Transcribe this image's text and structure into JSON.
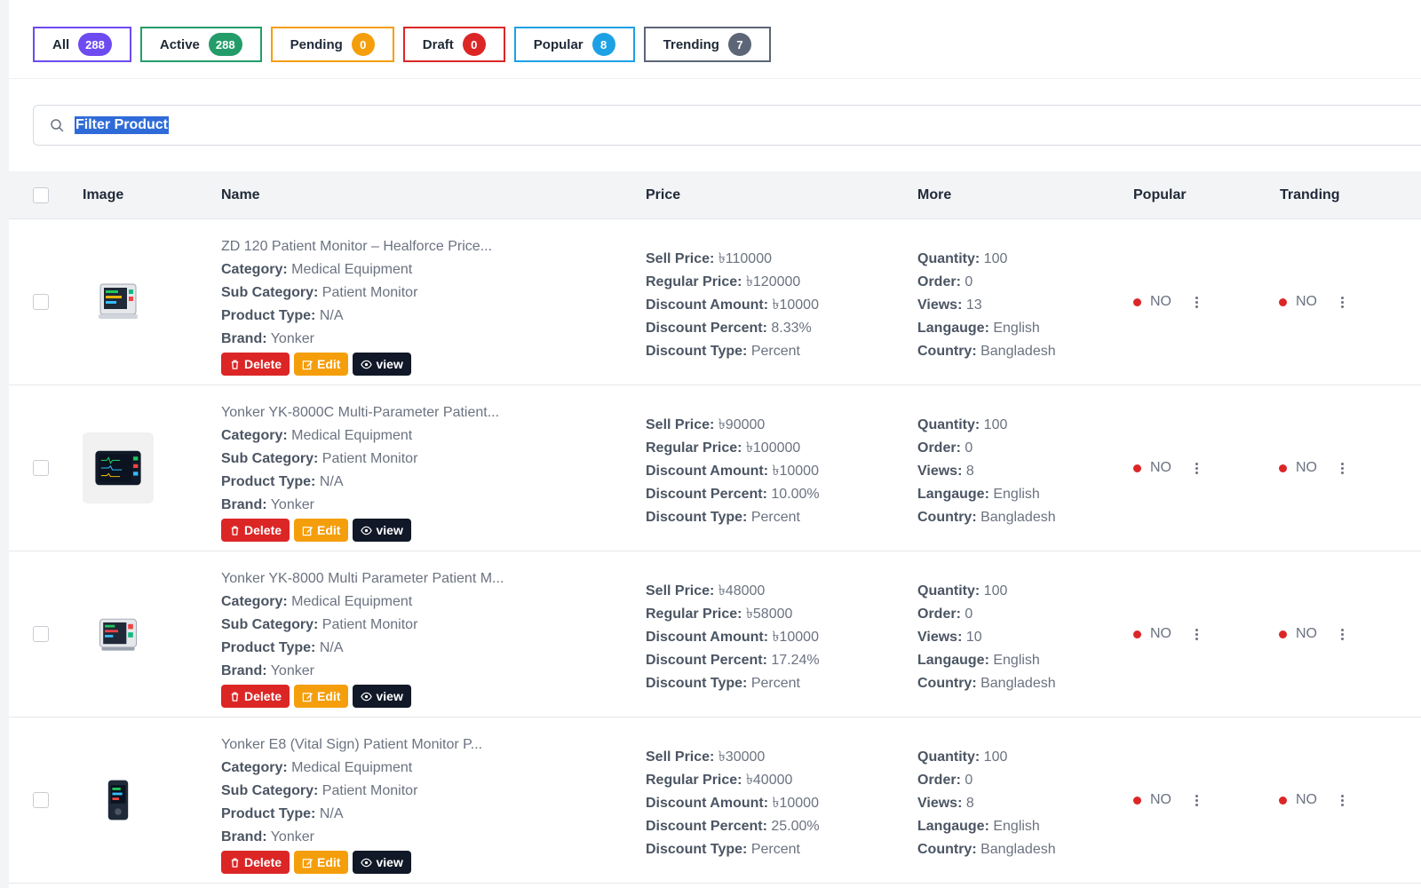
{
  "tabs": [
    {
      "label": "All",
      "count": "288",
      "color": "#6d4bf0"
    },
    {
      "label": "Active",
      "count": "288",
      "color": "#249c6a"
    },
    {
      "label": "Pending",
      "count": "0",
      "color": "#f59e0b"
    },
    {
      "label": "Draft",
      "count": "0",
      "color": "#dc2626"
    },
    {
      "label": "Popular",
      "count": "8",
      "color": "#1da1e5"
    },
    {
      "label": "Trending",
      "count": "7",
      "color": "#5d6677"
    }
  ],
  "search": {
    "value": "Filter Product"
  },
  "columns": {
    "image": "Image",
    "name": "Name",
    "price": "Price",
    "more": "More",
    "popular": "Popular",
    "trending": "Tranding"
  },
  "labels": {
    "category": "Category:",
    "sub_category": "Sub Category:",
    "product_type": "Product Type:",
    "brand": "Brand:",
    "sell_price": "Sell Price:",
    "regular_price": "Regular Price:",
    "discount_amount": "Discount Amount:",
    "discount_percent": "Discount Percent:",
    "discount_type": "Discount Type:",
    "quantity": "Quantity:",
    "order": "Order:",
    "views": "Views:",
    "language": "Langauge:",
    "country": "Country:",
    "delete": "Delete",
    "edit": "Edit",
    "view": "view"
  },
  "rows": [
    {
      "title": "ZD 120 Patient Monitor – Healforce Price...",
      "category": "Medical Equipment",
      "sub_category": "Patient Monitor",
      "product_type": "N/A",
      "brand": "Yonker",
      "sell_price": "৳110000",
      "regular_price": "৳120000",
      "discount_amount": "৳10000",
      "discount_percent": "8.33%",
      "discount_type": "Percent",
      "quantity": "100",
      "order": "0",
      "views": "13",
      "language": "English",
      "country": "Bangladesh",
      "popular": "NO",
      "trending": "NO"
    },
    {
      "title": "Yonker YK-8000C Multi-Parameter Patient...",
      "category": "Medical Equipment",
      "sub_category": "Patient Monitor",
      "product_type": "N/A",
      "brand": "Yonker",
      "sell_price": "৳90000",
      "regular_price": "৳100000",
      "discount_amount": "৳10000",
      "discount_percent": "10.00%",
      "discount_type": "Percent",
      "quantity": "100",
      "order": "0",
      "views": "8",
      "language": "English",
      "country": "Bangladesh",
      "popular": "NO",
      "trending": "NO"
    },
    {
      "title": "Yonker YK-8000 Multi Parameter Patient M...",
      "category": "Medical Equipment",
      "sub_category": "Patient Monitor",
      "product_type": "N/A",
      "brand": "Yonker",
      "sell_price": "৳48000",
      "regular_price": "৳58000",
      "discount_amount": "৳10000",
      "discount_percent": "17.24%",
      "discount_type": "Percent",
      "quantity": "100",
      "order": "0",
      "views": "10",
      "language": "English",
      "country": "Bangladesh",
      "popular": "NO",
      "trending": "NO"
    },
    {
      "title": "Yonker E8 (Vital Sign) Patient Monitor P...",
      "category": "Medical Equipment",
      "sub_category": "Patient Monitor",
      "product_type": "N/A",
      "brand": "Yonker",
      "sell_price": "৳30000",
      "regular_price": "৳40000",
      "discount_amount": "৳10000",
      "discount_percent": "25.00%",
      "discount_type": "Percent",
      "quantity": "100",
      "order": "0",
      "views": "8",
      "language": "English",
      "country": "Bangladesh",
      "popular": "NO",
      "trending": "NO"
    }
  ]
}
